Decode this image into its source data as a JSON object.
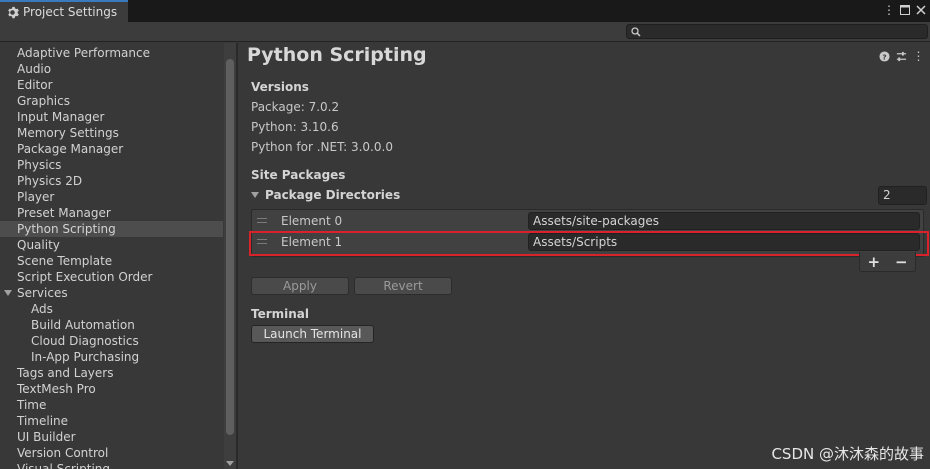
{
  "window": {
    "tab_title": "Project Settings",
    "tab_icon": "gear-icon"
  },
  "search": {
    "placeholder": ""
  },
  "sidebar": {
    "items": [
      {
        "label": "Adaptive Performance",
        "level": 0
      },
      {
        "label": "Audio",
        "level": 0
      },
      {
        "label": "Editor",
        "level": 0
      },
      {
        "label": "Graphics",
        "level": 0
      },
      {
        "label": "Input Manager",
        "level": 0
      },
      {
        "label": "Memory Settings",
        "level": 0
      },
      {
        "label": "Package Manager",
        "level": 0
      },
      {
        "label": "Physics",
        "level": 0
      },
      {
        "label": "Physics 2D",
        "level": 0
      },
      {
        "label": "Player",
        "level": 0
      },
      {
        "label": "Preset Manager",
        "level": 0
      },
      {
        "label": "Python Scripting",
        "level": 0,
        "selected": true
      },
      {
        "label": "Quality",
        "level": 0
      },
      {
        "label": "Scene Template",
        "level": 0
      },
      {
        "label": "Script Execution Order",
        "level": 0
      },
      {
        "label": "Services",
        "level": 0,
        "group": true
      },
      {
        "label": "Ads",
        "level": 1
      },
      {
        "label": "Build Automation",
        "level": 1
      },
      {
        "label": "Cloud Diagnostics",
        "level": 1
      },
      {
        "label": "In-App Purchasing",
        "level": 1
      },
      {
        "label": "Tags and Layers",
        "level": 0
      },
      {
        "label": "TextMesh Pro",
        "level": 0
      },
      {
        "label": "Time",
        "level": 0
      },
      {
        "label": "Timeline",
        "level": 0
      },
      {
        "label": "UI Builder",
        "level": 0
      },
      {
        "label": "Version Control",
        "level": 0
      },
      {
        "label": "Visual Scripting",
        "level": 0
      }
    ]
  },
  "main": {
    "title": "Python Scripting",
    "versions": {
      "heading": "Versions",
      "package": "Package: 7.0.2",
      "python": "Python: 3.10.6",
      "dotnet": "Python for .NET: 3.0.0.0"
    },
    "site_packages": {
      "heading": "Site Packages",
      "foldout_label": "Package Directories",
      "count": "2",
      "elements": [
        {
          "label": "Element 0",
          "value": "Assets/site-packages"
        },
        {
          "label": "Element 1",
          "value": "Assets/Scripts"
        }
      ],
      "add_label": "+",
      "remove_label": "−"
    },
    "apply_label": "Apply",
    "revert_label": "Revert",
    "terminal": {
      "heading": "Terminal",
      "launch_label": "Launch Terminal"
    }
  },
  "watermark": "CSDN @沐沐森的故事",
  "colors": {
    "highlight": "#d9232a",
    "accent": "#3a79bb"
  }
}
